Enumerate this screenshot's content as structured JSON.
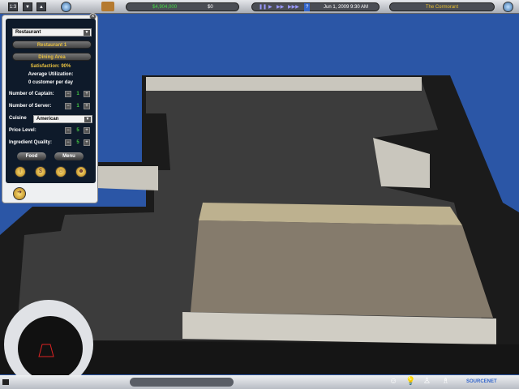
{
  "topbar": {
    "speed_label": "1:3",
    "down_label": "▼",
    "up_label": "▲",
    "money": "$4,904,000",
    "income": "$0",
    "help": "?",
    "datetime": "Jun 1, 2009  9:30 AM",
    "restaurant_name": "The Cormorant",
    "pause": "❚❚",
    "play": "▶",
    "fast": "▶▶",
    "faster": "▶▶▶"
  },
  "panel": {
    "category": "Restaurant",
    "restaurant": "Restaurant 1",
    "area": "Dining Area",
    "satisfaction": "Satisfaction: 90%",
    "utilization_label": "Average Utilization:",
    "utilization_value": "0 customer per day",
    "captain_label": "Number of Captain:",
    "captain_value": "1",
    "server_label": "Number of Server:",
    "server_value": "1",
    "cuisine_label": "Cuisine",
    "cuisine_value": "American",
    "price_label": "Price Level:",
    "price_value": "5",
    "quality_label": "Ingredient Quality:",
    "quality_value": "5",
    "food_button": "Food",
    "menu_button": "Menu",
    "minus": "−",
    "plus": "+",
    "close": "×"
  },
  "bottombar": {
    "brand": "SOURCENET"
  }
}
